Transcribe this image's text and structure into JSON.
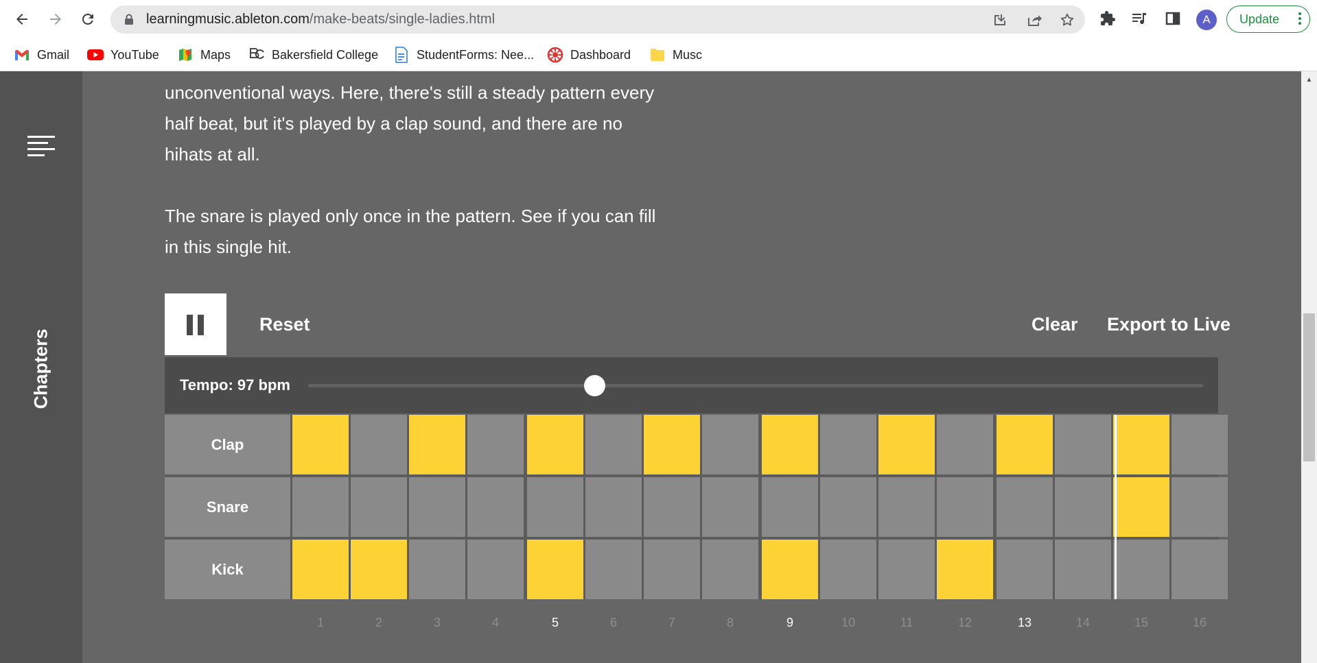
{
  "browser": {
    "url_domain": "learningmusic.ableton.com",
    "url_path": "/make-beats/single-ladies.html",
    "update_label": "Update",
    "avatar_letter": "A",
    "bookmarks": [
      {
        "label": "Gmail",
        "icon": "gmail-icon"
      },
      {
        "label": "YouTube",
        "icon": "youtube-icon"
      },
      {
        "label": "Maps",
        "icon": "maps-icon"
      },
      {
        "label": "Bakersfield College",
        "icon": "bakersfield-icon"
      },
      {
        "label": "StudentForms: Nee...",
        "icon": "forms-icon"
      },
      {
        "label": "Dashboard",
        "icon": "dashboard-icon"
      },
      {
        "label": "Musc",
        "icon": "folder-icon"
      }
    ]
  },
  "sidebar": {
    "chapters_label": "Chapters"
  },
  "content": {
    "paragraph1_lines": [
      "unconventional ways. Here, there's still a steady pattern every",
      "half beat, but it's played by a clap sound, and there are no",
      "hihats at all."
    ],
    "paragraph2_lines": [
      "The snare is played only once in the pattern. See if you can fill",
      "in this single hit."
    ]
  },
  "sequencer": {
    "reset_label": "Reset",
    "clear_label": "Clear",
    "export_label": "Export to Live",
    "tempo_label": "Tempo: 97 bpm",
    "tempo_slider_fraction": 0.32,
    "playhead_step": 15,
    "step_numbers": [
      "1",
      "2",
      "3",
      "4",
      "5",
      "6",
      "7",
      "8",
      "9",
      "10",
      "11",
      "12",
      "13",
      "14",
      "15",
      "16"
    ],
    "highlighted_steps": [
      5,
      9,
      13
    ],
    "active_color": "#fcd235",
    "rows": [
      {
        "name": "Clap",
        "steps": [
          1,
          0,
          1,
          0,
          1,
          0,
          1,
          0,
          1,
          0,
          1,
          0,
          1,
          0,
          1,
          0
        ]
      },
      {
        "name": "Snare",
        "steps": [
          0,
          0,
          0,
          0,
          0,
          0,
          0,
          0,
          0,
          0,
          0,
          0,
          0,
          0,
          1,
          0
        ]
      },
      {
        "name": "Kick",
        "steps": [
          1,
          1,
          0,
          0,
          1,
          0,
          0,
          0,
          1,
          0,
          0,
          1,
          0,
          0,
          0,
          0
        ]
      }
    ]
  }
}
